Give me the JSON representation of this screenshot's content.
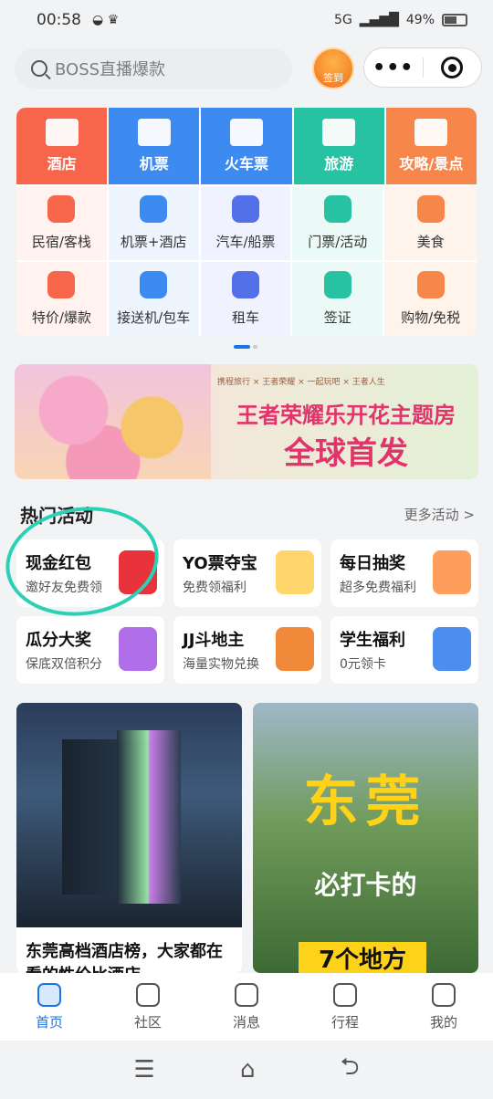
{
  "status_bar": {
    "time": "00:58",
    "network": "5G",
    "battery": "49%",
    "battery_level": 0.49
  },
  "search": {
    "placeholder": "BOSS直播爆款"
  },
  "signin": {
    "label": "签到"
  },
  "capsule": {
    "menu_icon": "more-dots-icon",
    "close_icon": "target-icon"
  },
  "top_categories": [
    {
      "label": "酒店",
      "color": "#f7664a",
      "icon": "hotel-icon"
    },
    {
      "label": "机票",
      "color": "#3d8af0",
      "icon": "plane-icon"
    },
    {
      "label": "火车票",
      "color": "#3d8af0",
      "icon": "train-icon"
    },
    {
      "label": "旅游",
      "color": "#27c2a1",
      "icon": "palm-icon"
    },
    {
      "label": "攻略/景点",
      "color": "#f7864a",
      "icon": "guide-icon"
    }
  ],
  "sub_categories": [
    {
      "label": "民宿/客栈",
      "color": "#f7664a"
    },
    {
      "label": "机票+酒店",
      "color": "#3d8af0"
    },
    {
      "label": "汽车/船票",
      "color": "#5470e8"
    },
    {
      "label": "门票/活动",
      "color": "#27c2a1"
    },
    {
      "label": "美食",
      "color": "#f7864a"
    },
    {
      "label": "特价/爆款",
      "color": "#f7664a"
    },
    {
      "label": "接送机/包车",
      "color": "#3d8af0"
    },
    {
      "label": "租车",
      "color": "#5470e8"
    },
    {
      "label": "签证",
      "color": "#27c2a1"
    },
    {
      "label": "购物/免税",
      "color": "#f7864a"
    }
  ],
  "banner": {
    "partners": "携程旅行 × 王者荣耀 × 一起玩吧 × 王者人生",
    "title_line1": "王者荣耀乐开花主题房",
    "title_line2": "全球首发"
  },
  "hot": {
    "title": "热门活动",
    "more": "更多活动 >",
    "items": [
      {
        "title": "现金红包",
        "subtitle": "邀好友免费领",
        "img_color": "#e8323c"
      },
      {
        "title": "YO票夺宝",
        "subtitle": "免费领福利",
        "img_color": "#ffd66b"
      },
      {
        "title": "每日抽奖",
        "subtitle": "超多免费福利",
        "img_color": "#ff9d5c"
      },
      {
        "title": "瓜分大奖",
        "subtitle": "保底双倍积分",
        "img_color": "#b06ee8"
      },
      {
        "title": "JJ斗地主",
        "subtitle": "海量实物兑换",
        "img_color": "#f08a3a"
      },
      {
        "title": "学生福利",
        "subtitle": "0元领卡",
        "img_color": "#4b8ef0"
      }
    ]
  },
  "feed": {
    "card1_title": "东莞高档酒店榜，大家都在看的性价比酒店",
    "card2_big": "东莞",
    "card2_mid": "必打卡的",
    "card2_bottom": "7个地方"
  },
  "tabbar": [
    {
      "label": "首页",
      "icon": "home-icon",
      "active": true
    },
    {
      "label": "社区",
      "icon": "planet-icon",
      "active": false
    },
    {
      "label": "消息",
      "icon": "message-icon",
      "active": false
    },
    {
      "label": "行程",
      "icon": "calendar-icon",
      "active": false
    },
    {
      "label": "我的",
      "icon": "user-icon",
      "active": false
    }
  ],
  "system_nav": {
    "menu": "☰",
    "home": "⌂",
    "back": "⮌"
  }
}
